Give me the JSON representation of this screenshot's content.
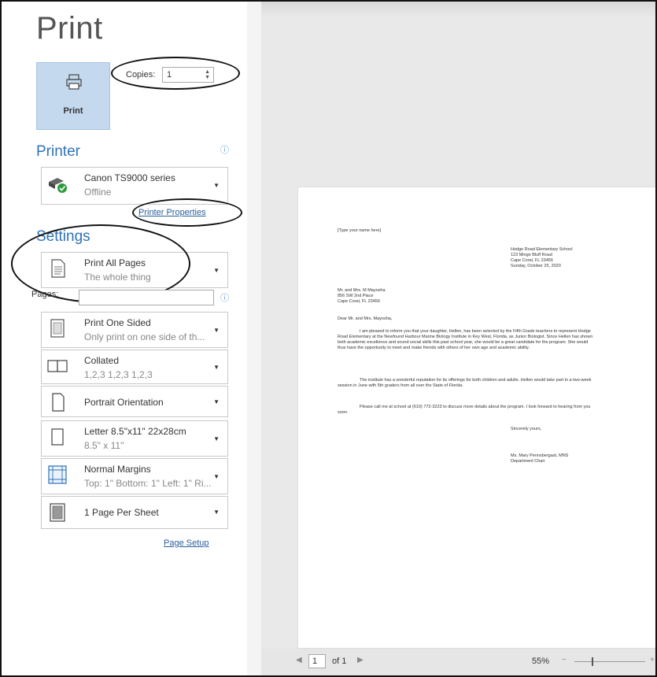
{
  "title": "Print",
  "print_button": {
    "label": "Print"
  },
  "copies": {
    "label": "Copies:",
    "value": "1"
  },
  "printer": {
    "heading": "Printer",
    "name": "Canon TS9000 series",
    "status": "Offline",
    "properties_link": "Printer Properties"
  },
  "settings": {
    "heading": "Settings",
    "print_range": {
      "title": "Print All Pages",
      "subtitle": "The whole thing"
    },
    "pages_label": "Pages:",
    "sides": {
      "title": "Print One Sided",
      "subtitle": "Only print on one side of th..."
    },
    "collation": {
      "title": "Collated",
      "subtitle": "1,2,3   1,2,3   1,2,3"
    },
    "orientation": {
      "title": "Portrait Orientation"
    },
    "paper": {
      "title": "Letter 8.5\"x11\" 22x28cm",
      "subtitle": "8.5\" x 11\""
    },
    "margins": {
      "title": "Normal Margins",
      "subtitle": "Top: 1\" Bottom: 1\" Left: 1\" Ri..."
    },
    "per_sheet": {
      "title": "1 Page Per Sheet"
    },
    "page_setup_link": "Page Setup"
  },
  "preview": {
    "name_placeholder": "[Type your name here]",
    "address": [
      "Hodge Road Elementary School",
      "123 Mingo Bluff Road",
      "Cape Coral, FL 23456",
      "Sunday, October 25, 2020"
    ],
    "recipient": [
      "Mr. and Mrs. M Mayosha",
      "856 SW 2nd Place",
      "Cape Coral, FL 23456"
    ],
    "greeting": "Dear Mr. and Mrs. Mayosha,",
    "paragraphs": [
      "I am pleased to inform you that your daughter, Hellen, has been selected by the Fifth Grade teachers to represent Hodge Road Elementary at the Newfound Harbour Marine Biology Institute in Key West, Florida, as Junior Biologist. Since Hellen has shown both academic excellence and sound social skills this past school year, she would be a great candidate for the program. She would thus have the opportunity to meet and make friends with others of her own age and academic ability.",
      "The institute has a wonderful reputation for its offerings for both children and adults. Hellen would take part in a two-week session in June with 5th graders from all over the State of Florida.",
      "Please call me at school at (619) 772-3223 to discuss more details about the program. I look forward to hearing from you soon."
    ],
    "closing": "Sincerely yours,",
    "signature": [
      "Ms. Mary Pennsbergast, MNS",
      "Department Chair"
    ]
  },
  "footer": {
    "page": "1",
    "of": "of 1",
    "zoom": "55%"
  }
}
